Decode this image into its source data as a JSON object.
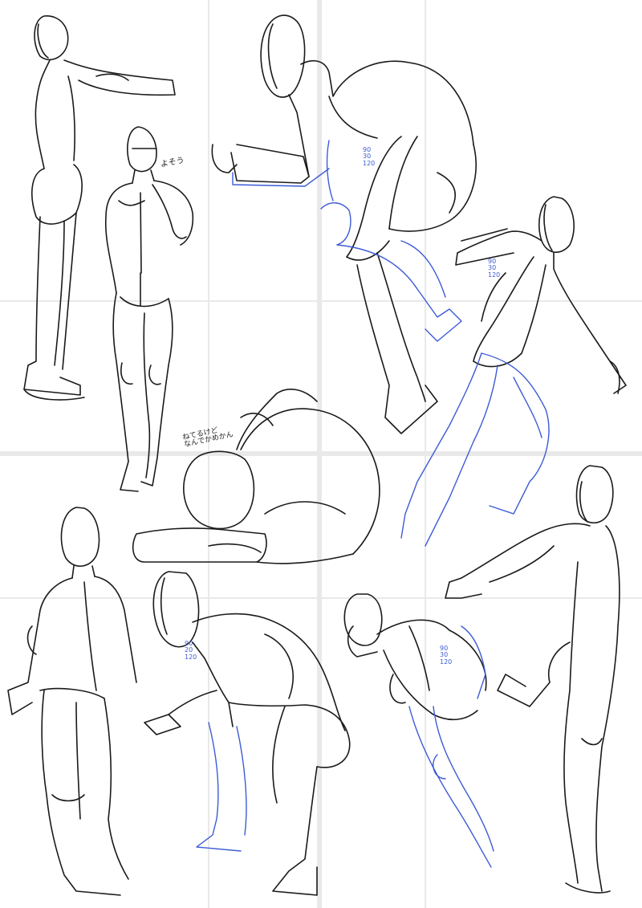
{
  "page": {
    "background": "#ffffff"
  },
  "colors": {
    "ink": "#1a1a1a",
    "blue_construction": "#3c5bd6",
    "guide": "#e9e9e9"
  },
  "annotations": {
    "figure2_note": "よそう",
    "figure4_angles": "90\n30\n120",
    "figure5_angles": "90\n30\n120",
    "figure6_note": "ねてるけど\nなんでかめかん",
    "figure8_angles": "90\n20\n120",
    "figure9_angles": "90\n30\n120"
  }
}
